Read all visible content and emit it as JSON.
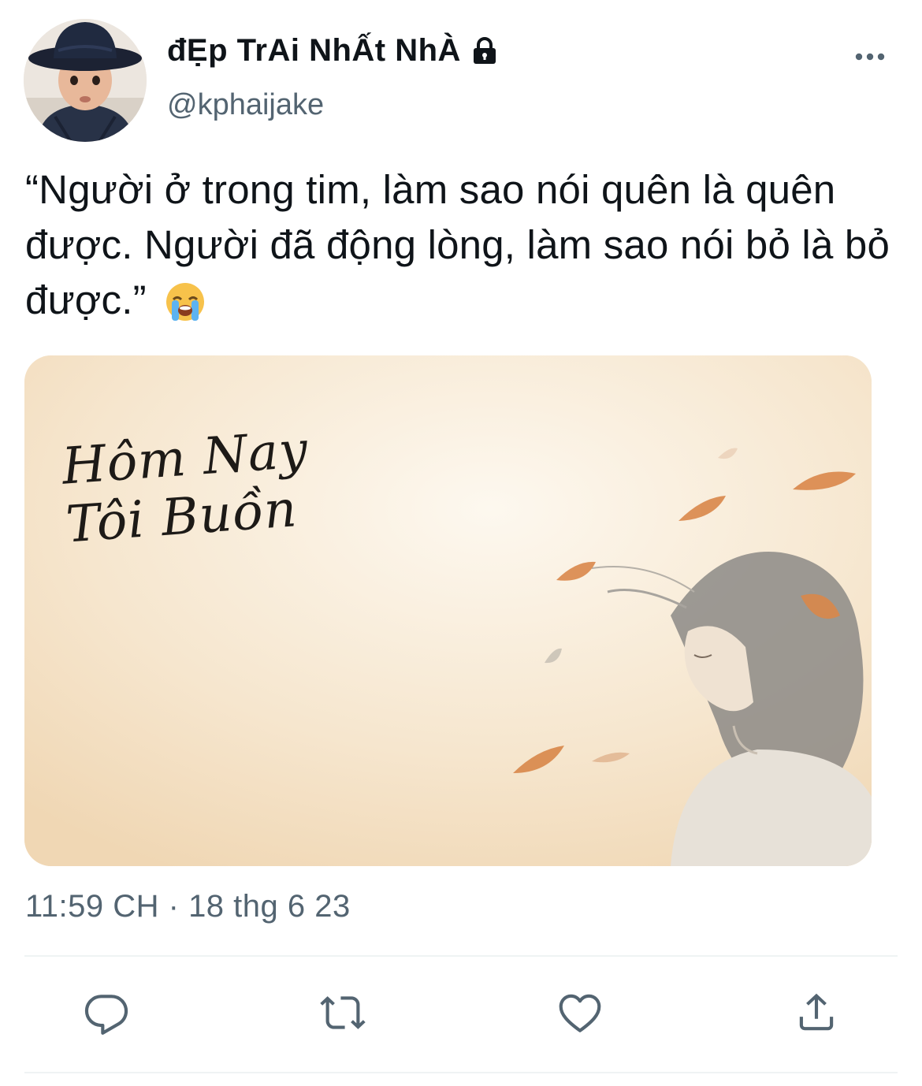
{
  "user": {
    "display_name": "đẸp TrAi NhẤt NhÀ",
    "handle": "@kphaijake",
    "protected_icon": "lock-icon",
    "avatar": "avatar"
  },
  "menu": {
    "icon": "more-horizontal-icon"
  },
  "tweet": {
    "text": "“Người ở trong tim, làm sao nói quên là quên được. Người đã động lòng, làm sao nói bỏ là bỏ được.”",
    "emoji": "loudly-crying-face-emoji",
    "timestamp": "11:59 CH · 18 thg 6 23"
  },
  "media": {
    "artwork_text": "Hôm Nay Tôi Buồn",
    "description_icon": "girl-with-falling-leaves-illustration"
  },
  "actions": [
    {
      "icon": "reply-icon"
    },
    {
      "icon": "retweet-icon"
    },
    {
      "icon": "like-icon"
    },
    {
      "icon": "share-icon"
    }
  ],
  "colors": {
    "text_primary": "#0f1419",
    "text_secondary": "#536471",
    "icon": "#536471",
    "divider": "#eff3f4",
    "background": "#ffffff"
  }
}
